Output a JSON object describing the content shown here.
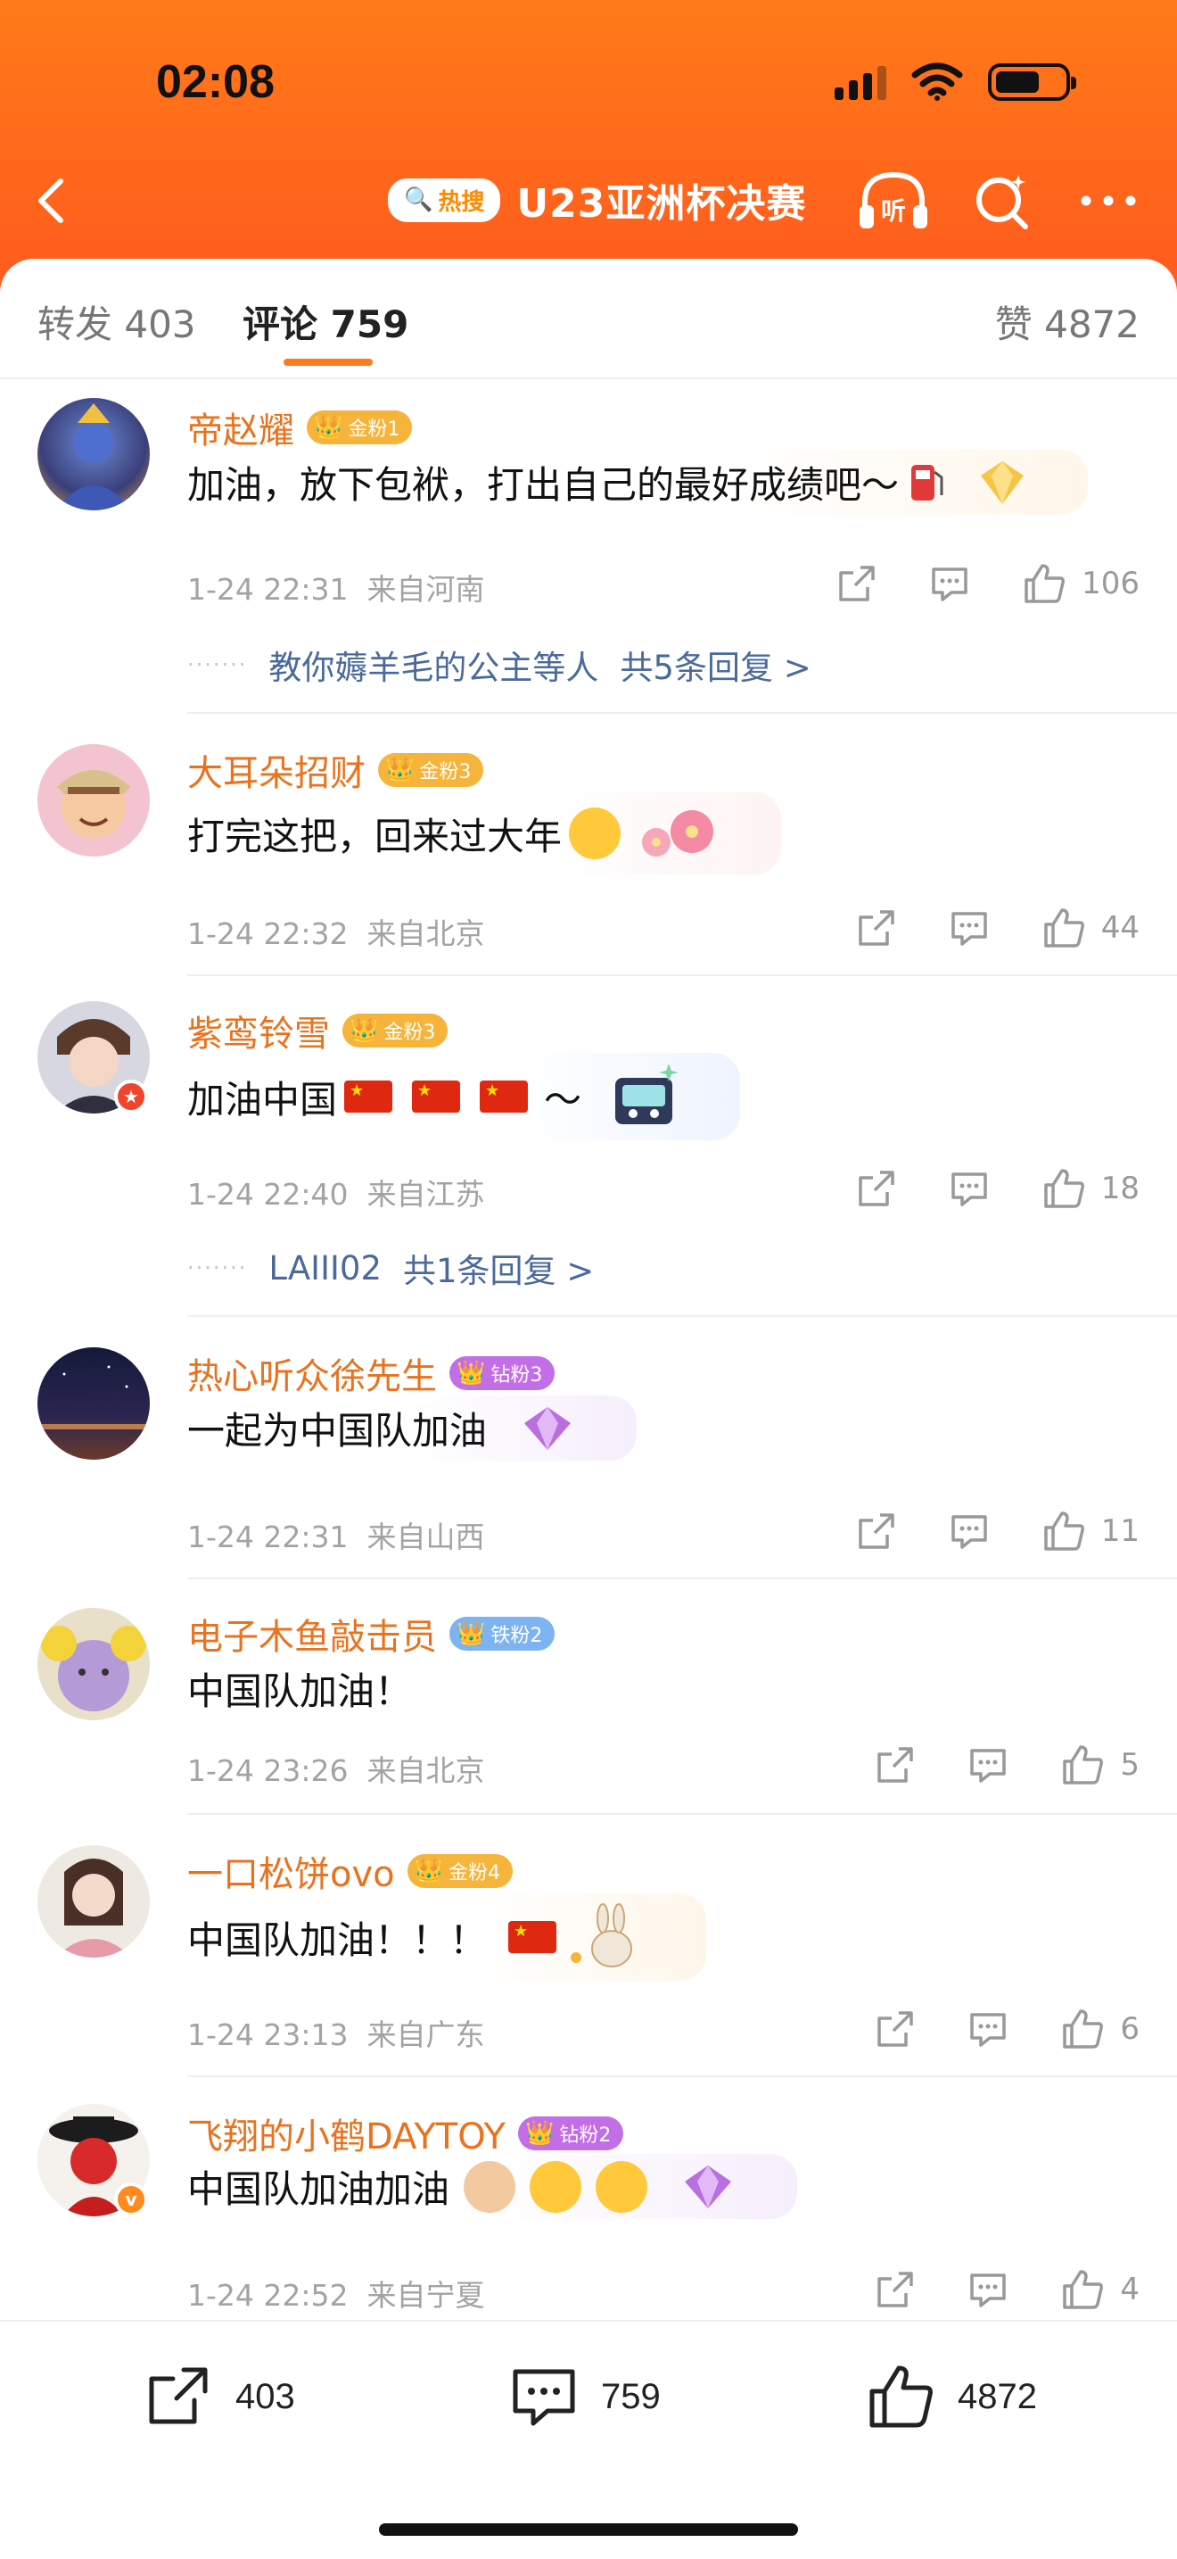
{
  "status_bar": {
    "time": "02:08"
  },
  "header": {
    "hot_badge": "热搜",
    "title": "U23亚洲杯决赛"
  },
  "tabs": {
    "repost": "转发 403",
    "comments": "评论 759",
    "likes": "赞 4872"
  },
  "comments": [
    {
      "name": "帝赵耀",
      "fan_badge": "金粉1",
      "fan_color": "#f6b43a",
      "text": "加油，放下包袱，打出自己的最好成绩吧～",
      "time": "1-24 22:31",
      "location": "来自河南",
      "likes": "106",
      "replies": {
        "users": "教你薅羊毛的公主等人",
        "count": "共5条回复 >"
      }
    },
    {
      "name": "大耳朵招财",
      "fan_badge": "金粉3",
      "fan_color": "#f6b43a",
      "text": "打完这把，回来过大年",
      "time": "1-24 22:32",
      "location": "来自北京",
      "likes": "44"
    },
    {
      "name": "紫鸾铃雪",
      "fan_badge": "金粉3",
      "fan_color": "#f6b43a",
      "text": "加油中国",
      "text_suffix": "～",
      "time": "1-24 22:40",
      "location": "来自江苏",
      "likes": "18",
      "replies": {
        "users": "LAIII02",
        "count": "共1条回复 >"
      }
    },
    {
      "name": "热心听众徐先生",
      "fan_badge": "钻粉3",
      "fan_color": "#c26ee6",
      "text": "一起为中国队加油",
      "time": "1-24 22:31",
      "location": "来自山西",
      "likes": "11"
    },
    {
      "name": "电子木鱼敲击员",
      "fan_badge": "铁粉2",
      "fan_color": "#7db3f0",
      "text": "中国队加油！",
      "time": "1-24 23:26",
      "location": "来自北京",
      "likes": "5"
    },
    {
      "name": "一口松饼ovo",
      "fan_badge": "金粉4",
      "fan_color": "#f6b43a",
      "text": "中国队加油！！！",
      "time": "1-24 23:13",
      "location": "来自广东",
      "likes": "6"
    },
    {
      "name": "飞翔的小鹤DAYTOY",
      "fan_badge": "钻粉2",
      "fan_color": "#c26ee6",
      "text": "中国队加油加油",
      "time": "1-24 22:52",
      "location": "来自宁夏",
      "likes": "4"
    }
  ],
  "bottom_bar": {
    "reposts": "403",
    "comments": "759",
    "likes": "4872"
  },
  "colors": {
    "header_orange": "#ff6a1a",
    "name_orange": "#e8731e",
    "link_blue": "#4a6a9c",
    "tab_indicator": "#ff7a1f"
  }
}
